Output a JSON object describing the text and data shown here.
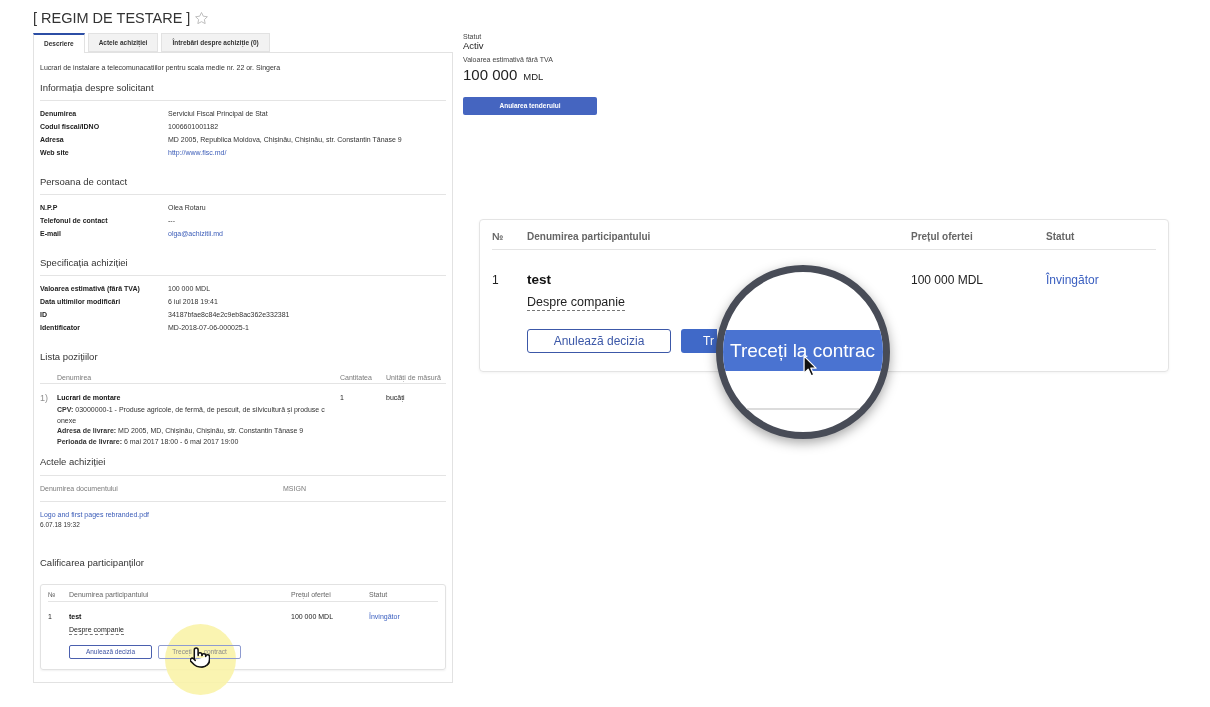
{
  "header": {
    "title": "[ REGIM DE TESTARE ]",
    "starred": false
  },
  "tabs": [
    {
      "label": "Descriere",
      "selected": true
    },
    {
      "label": "Actele achiziției",
      "selected": false
    },
    {
      "label": "Întrebări despre achiziție (0)",
      "selected": false
    }
  ],
  "description": "Lucrari de instalare a telecomunacatiilor pentru scala medie nr. 22 or. Singera",
  "sections": [
    {
      "kind": "fields",
      "title": "Informația despre solicitant",
      "fields": [
        {
          "label": "Denumirea",
          "value": "Serviciul Fiscal Principal de Stat",
          "link": false
        },
        {
          "label": "Codul fiscal/IDNO",
          "value": "1006601001182",
          "link": false
        },
        {
          "label": "Adresa",
          "value": "MD 2005, Republica Moldova, Chișinău, Chișinău, str. Constantin Tănase 9",
          "link": false
        },
        {
          "label": "Web site",
          "value": "http://www.fisc.md/",
          "link": true
        }
      ]
    },
    {
      "kind": "fields",
      "title": "Persoana de contact",
      "fields": [
        {
          "label": "N.P.P",
          "value": "Olea Rotaru",
          "link": false
        },
        {
          "label": "Telefonul de contact",
          "value": "---",
          "link": false
        },
        {
          "label": "E-mail",
          "value": "olga@achizitii.md",
          "link": true
        }
      ]
    },
    {
      "kind": "fields",
      "title": "Specificația achiziției",
      "fields": [
        {
          "label": "Valoarea estimativă (fără TVA)",
          "value": "100 000 MDL",
          "link": false
        },
        {
          "label": "Data ultimilor modificări",
          "value": "6 iul 2018 19:41",
          "link": false
        },
        {
          "label": "ID",
          "value": "34187bfae8c84e2c9eb8ac362e332381",
          "link": false
        },
        {
          "label": "Identificator",
          "value": "MD-2018-07-06-000025-1",
          "link": false
        }
      ]
    },
    {
      "kind": "positions",
      "title": "Lista pozițiilor",
      "columns": [
        "Denumirea",
        "Cantitatea",
        "Unități de măsură"
      ],
      "items": [
        {
          "number": "1)",
          "name": "Lucrari de montare",
          "quantity": "1",
          "unit": "bucăți",
          "details": [
            [
              "**CPV:** 03000000-1 - Produse agricole, de fermă, de pescuit, de silvicultură și produse c",
              "onexe"
            ],
            [
              "**Adresa de livrare:** MD 2005, MD, Chișinău, Chișinău, str. Constantin Tănase 9"
            ],
            [
              "**Perioada de livrare:** 6 mai 2017 18:00 - 6 mai 2017 19:00"
            ]
          ]
        }
      ]
    },
    {
      "kind": "documents",
      "title": "Actele achiziției",
      "columns": [
        "Denumirea documentului",
        "MSIGN"
      ],
      "files": [
        {
          "name": "Logo and first pages rebranded.pdf",
          "date": "6.07.18 19:32"
        }
      ]
    },
    {
      "kind": "qualification",
      "title": "Calificarea participanților",
      "columns": [
        "№",
        "Denumirea participantului",
        "Prețul ofertei",
        "Statut"
      ],
      "rows": [
        {
          "number": "1",
          "name": "test",
          "about": "Despre companie",
          "price": "100 000 MDL",
          "status": "Învingător",
          "buttons": [
            {
              "kind": "outline",
              "label": [
                "Anulează decizia"
              ],
              "highlighted": false
            },
            {
              "kind": "outline",
              "label": [
                "Treceți",
                "contract"
              ],
              "highlighted": true
            }
          ]
        }
      ]
    }
  ],
  "summary": {
    "status_label": "Statut",
    "status": "Activ",
    "value_label": "Valoarea estimativă fără TVA",
    "amount": "100 000",
    "currency": "MDL",
    "button": "Anularea tenderului"
  },
  "zoomed_table": {
    "columns": [
      "№",
      "Denumirea participantului",
      "Prețul ofertei",
      "Statut"
    ],
    "rows": [
      {
        "number": "1",
        "name": "test",
        "about": "Despre companie",
        "price": "100 000 MDL",
        "status": "Învingător",
        "buttons": [
          {
            "kind": "outline",
            "label": [
              "Anulează decizia"
            ],
            "highlighted": false
          },
          {
            "kind": "primary",
            "label": [
              "Tr"
            ],
            "highlighted": false
          }
        ]
      }
    ]
  },
  "magnifier": {
    "text": "Treceți la contrac"
  }
}
